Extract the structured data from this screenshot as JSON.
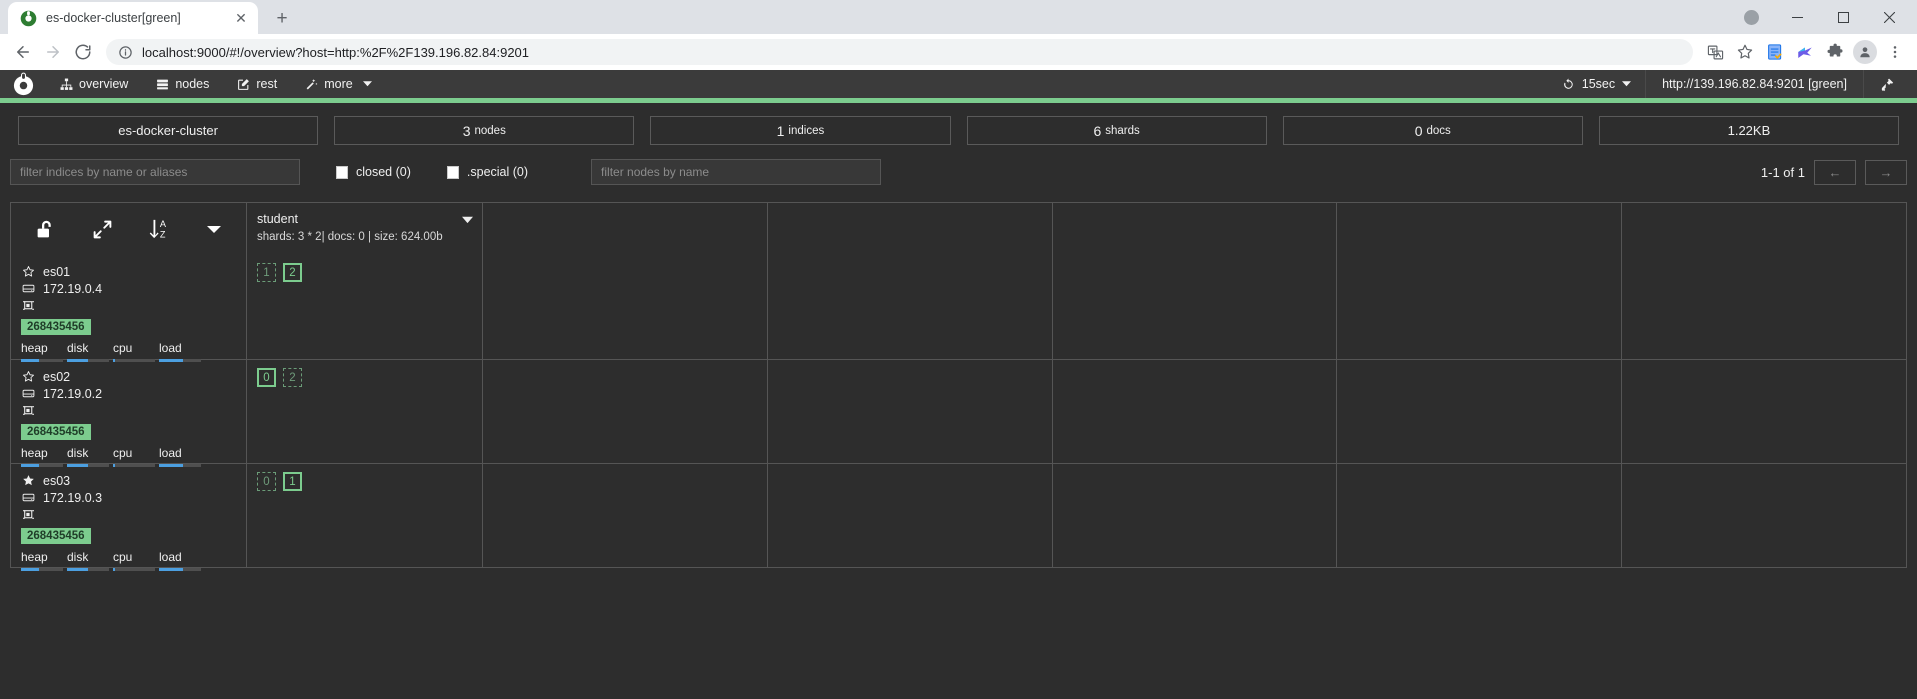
{
  "browser": {
    "tab": {
      "title": "es-docker-cluster[green]",
      "favicon": "cerebro-logo-icon",
      "close_label": "✕"
    },
    "new_tab_label": "+",
    "window_controls": {
      "minimize": "—",
      "maximize": "□",
      "close": "✕"
    },
    "omnibox": {
      "url": "localhost:9000/#!/overview?host=http:%2F%2F139.196.82.84:9201",
      "info_icon": "site-info-icon"
    },
    "toolbar_icons": [
      "translate-icon",
      "bookmark-star-icon",
      "reading-list-icon",
      "extension-bird-icon",
      "extensions-puzzle-icon",
      "profile-avatar-icon",
      "chrome-menu-icon"
    ]
  },
  "navbar": {
    "brand": "cerebro-logo",
    "links": [
      {
        "label": "overview",
        "icon": "sitemap-icon"
      },
      {
        "label": "nodes",
        "icon": "server-icon"
      },
      {
        "label": "rest",
        "icon": "edit-icon"
      },
      {
        "label": "more",
        "icon": "magic-wand-icon",
        "caret": "▼"
      }
    ],
    "refresh": {
      "label": "15sec",
      "icon": "refresh-icon",
      "caret": "▼"
    },
    "host": "http://139.196.82.84:9201 [green]",
    "disconnect_icon": "plug-icon"
  },
  "health_color": "#7ccc8e",
  "stats": [
    {
      "name": "cluster-name",
      "value": "es-docker-cluster",
      "label": ""
    },
    {
      "name": "nodes-count",
      "value": "3",
      "label": "nodes"
    },
    {
      "name": "indices-count",
      "value": "1",
      "label": "indices"
    },
    {
      "name": "shards-count",
      "value": "6",
      "label": "shards"
    },
    {
      "name": "docs-count",
      "value": "0",
      "label": "docs"
    },
    {
      "name": "store-size",
      "value": "1.22KB",
      "label": ""
    }
  ],
  "filters": {
    "indices_placeholder": "filter indices by name or aliases",
    "closed_label": "closed (0)",
    "special_label": ".special (0)",
    "nodes_placeholder": "filter nodes by name",
    "pager_label": "1-1 of 1",
    "prev_label": "←",
    "next_label": "→"
  },
  "table": {
    "header_tools": [
      {
        "name": "toggle-lock-icon",
        "glyph": "unlock"
      },
      {
        "name": "expand-arrows-icon",
        "glyph": "expand"
      },
      {
        "name": "sort-az-icon",
        "glyph": "sort"
      },
      {
        "name": "caret-down-icon",
        "glyph": "caret"
      }
    ],
    "indices": [
      {
        "name": "student",
        "meta": "shards: 3 * 2| docs: 0 | size: 624.00b",
        "caret": "▼"
      }
    ],
    "nodes": [
      {
        "name": "es01",
        "master": false,
        "ip": "172.19.0.4",
        "heap_bytes": "268435456",
        "metrics": [
          {
            "label": "heap",
            "pct": 44
          },
          {
            "label": "disk",
            "pct": 50
          },
          {
            "label": "cpu",
            "pct": 4
          },
          {
            "label": "load",
            "pct": 56
          }
        ],
        "shards": [
          {
            "num": "1",
            "type": "replica"
          },
          {
            "num": "2",
            "type": "primary"
          }
        ]
      },
      {
        "name": "es02",
        "master": false,
        "ip": "172.19.0.2",
        "heap_bytes": "268435456",
        "metrics": [
          {
            "label": "heap",
            "pct": 44
          },
          {
            "label": "disk",
            "pct": 50
          },
          {
            "label": "cpu",
            "pct": 4
          },
          {
            "label": "load",
            "pct": 56
          }
        ],
        "shards": [
          {
            "num": "0",
            "type": "primary"
          },
          {
            "num": "2",
            "type": "replica"
          }
        ]
      },
      {
        "name": "es03",
        "master": true,
        "ip": "172.19.0.3",
        "heap_bytes": "268435456",
        "metrics": [
          {
            "label": "heap",
            "pct": 44
          },
          {
            "label": "disk",
            "pct": 50
          },
          {
            "label": "cpu",
            "pct": 4
          },
          {
            "label": "load",
            "pct": 56
          }
        ],
        "shards": [
          {
            "num": "0",
            "type": "replica"
          },
          {
            "num": "1",
            "type": "primary"
          }
        ]
      }
    ],
    "empty_columns": 5
  }
}
